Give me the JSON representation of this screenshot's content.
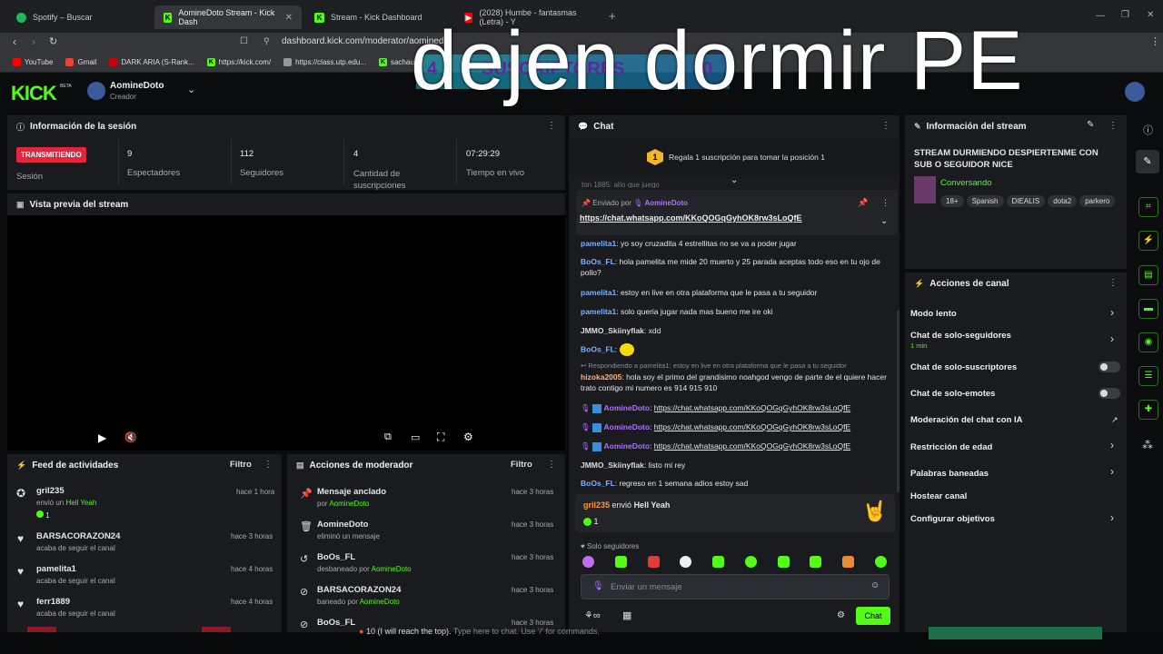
{
  "browser": {
    "tabs": [
      {
        "label": "Spotify – Buscar",
        "icon": "spotify-icon"
      },
      {
        "label": "AomineDoto Stream - Kick Dash",
        "icon": "kick-icon"
      },
      {
        "label": "Stream - Kick Dashboard",
        "icon": "kick-icon"
      },
      {
        "label": "(2028) Humbe - fantasmas (Letra) - Y",
        "icon": "youtube-icon"
      }
    ],
    "url": "dashboard.kick.com/moderator/aominedoto",
    "bookmarks": [
      "YouTube",
      "Gmail",
      "DARK ARIA (S-Rank...",
      "https://kick.com/",
      "https://class.utp.edu...",
      "sachauzu"
    ]
  },
  "overlay": {
    "big_text": "dejen dormir PE",
    "sub_count": "4",
    "sub_label": "SUSCRIPTORES",
    "sub_goal": "10"
  },
  "header": {
    "logo": "KICK",
    "beta": "BETA",
    "username": "AomineDoto",
    "role": "Creador"
  },
  "session": {
    "title": "Información de la sesión",
    "status_badge": "TRANSMITIENDO",
    "status_label": "Sesión",
    "stats": [
      {
        "value": "9",
        "label": "Espectadores"
      },
      {
        "value": "112",
        "label": "Seguidores"
      },
      {
        "value": "4",
        "label": "Cantidad de suscripciones"
      },
      {
        "value": "07:29:29",
        "label": "Tiempo en vivo"
      }
    ]
  },
  "preview": {
    "title": "Vista previa del stream"
  },
  "feed": {
    "title": "Feed de actividades",
    "filter": "Filtro",
    "items": [
      {
        "user": "gril235",
        "action": "envió un ",
        "highlight": "Hell Yeah",
        "count": "1",
        "time": "hace 1 hora"
      },
      {
        "user": "BARSACORAZON24",
        "action": "acaba de seguir el canal",
        "time": "hace 3 horas"
      },
      {
        "user": "pamelita1",
        "action": "acaba de seguir el canal",
        "time": "hace 4 horas"
      },
      {
        "user": "ferr1889",
        "action": "acaba de seguir el canal",
        "time": "hace 4 horas"
      }
    ]
  },
  "modactions": {
    "title": "Acciones de moderador",
    "filter": "Filtro",
    "items": [
      {
        "title": "Mensaje anclado",
        "sub": "por ",
        "sub_user": "AomineDoto",
        "time": "hace 3 horas"
      },
      {
        "title": "AomineDoto",
        "sub": "eliminó un mensaje",
        "sub_user": "",
        "time": "hace 3 horas"
      },
      {
        "title": "BoOs_FL",
        "sub": "desbaneado por ",
        "sub_user": "AomineDoto",
        "time": "hace 3 horas"
      },
      {
        "title": "BARSACORAZON24",
        "sub": "baneado por ",
        "sub_user": "AomineDoto",
        "time": "hace 3 horas"
      },
      {
        "title": "BoOs_FL",
        "sub": "",
        "sub_user": "",
        "time": "hace 3 horas"
      }
    ]
  },
  "chat": {
    "title": "Chat",
    "gift_rank": "1",
    "gift_text": "Regala 1 suscripción para tomar la posición 1",
    "pinned_by": "Enviado por",
    "pinned_user": "AomineDoto",
    "pinned_link": "https://chat.whatsapp.com/KKoQOGqGyhOK8rw3sLoQfE",
    "partial_line": "ton 1885: alío que juego",
    "messages": [
      {
        "user": "pamelita1",
        "text": ": yo soy cruzadita 4 estrellitas no se va a poder jugar"
      },
      {
        "user": "BoOs_FL",
        "text": ": hola pamelita me mide 20 muerto y 25 parada aceptas todo eso en tu ojo de pollo?"
      },
      {
        "user": "pamelita1",
        "text": ": estoy en live en otra plataforma que le pasa a tu seguidor"
      },
      {
        "user": "pamelita1",
        "text": ": solo queria jugar nada mas bueno me ire oki"
      },
      {
        "user": "JMMO_Skiinyflak",
        "text": ": xdd"
      },
      {
        "user": "BoOs_FL",
        "text": ":"
      },
      {
        "reply": "Respondiendo a pamelita1: estoy en live en otra plataforma que le pasa a tu seguidor",
        "user": "hizoka2005",
        "text": ": hola soy el primo del grandisimo noahgod vengo de parte de el quiere hacer trato contigo mi numero es 914 915 910"
      },
      {
        "user": "AomineDoto",
        "text": "https://chat.whatsapp.com/KKoQOGqGyhOK8rw3sLoQfE"
      },
      {
        "user": "AomineDoto",
        "text": "https://chat.whatsapp.com/KKoQOGqGyhOK8rw3sLoQfE"
      },
      {
        "user": "AomineDoto",
        "text": "https://chat.whatsapp.com/KKoQOGqGyhOK8rw3sLoQfE"
      },
      {
        "user": "JMMO_Skiinyflak",
        "text": ": listo mi rey"
      },
      {
        "user": "BoOs_FL",
        "text": ": regreso en 1 semana adios estoy sad"
      }
    ],
    "gift_event_user": "gril235",
    "gift_event_text": " envió ",
    "gift_event_item": "Hell Yeah",
    "gift_event_count": "1",
    "mode": "Solo seguidores",
    "placeholder": "Enviar un mensaje",
    "send": "Chat"
  },
  "streaminfo": {
    "title": "Información del stream",
    "stream_title": "STREAM DURMIENDO DESPIERTENME CON SUB O SEGUIDOR NICE",
    "category": "Conversando",
    "tags": [
      "18+",
      "Spanish",
      "DIEALIS",
      "dota2",
      "parkero"
    ]
  },
  "channel_actions": {
    "title": "Acciones de canal",
    "items": [
      {
        "label": "Modo lento",
        "control": "chevron"
      },
      {
        "label": "Chat de solo-seguidores",
        "sub": "1 min",
        "control": "chevron"
      },
      {
        "label": "Chat de solo-suscriptores",
        "control": "toggle"
      },
      {
        "label": "Chat de solo-emotes",
        "control": "toggle"
      },
      {
        "label": "Moderación del chat con IA",
        "control": "external"
      },
      {
        "label": "Restricción de edad",
        "control": "chevron"
      },
      {
        "label": "Palabras baneadas",
        "control": "chevron"
      },
      {
        "label": "Hostear canal",
        "control": "none"
      },
      {
        "label": "Configurar objetivos",
        "control": "chevron"
      }
    ]
  },
  "taskbar": {
    "text": "10 (I will reach the top).",
    "hint": "Type here to chat. Use '/' for commands."
  },
  "colors": {
    "kick_green": "#53fc18",
    "live_red": "#e0263b",
    "user_blue": "#7fb0ff",
    "user_purple": "#b070ff"
  }
}
